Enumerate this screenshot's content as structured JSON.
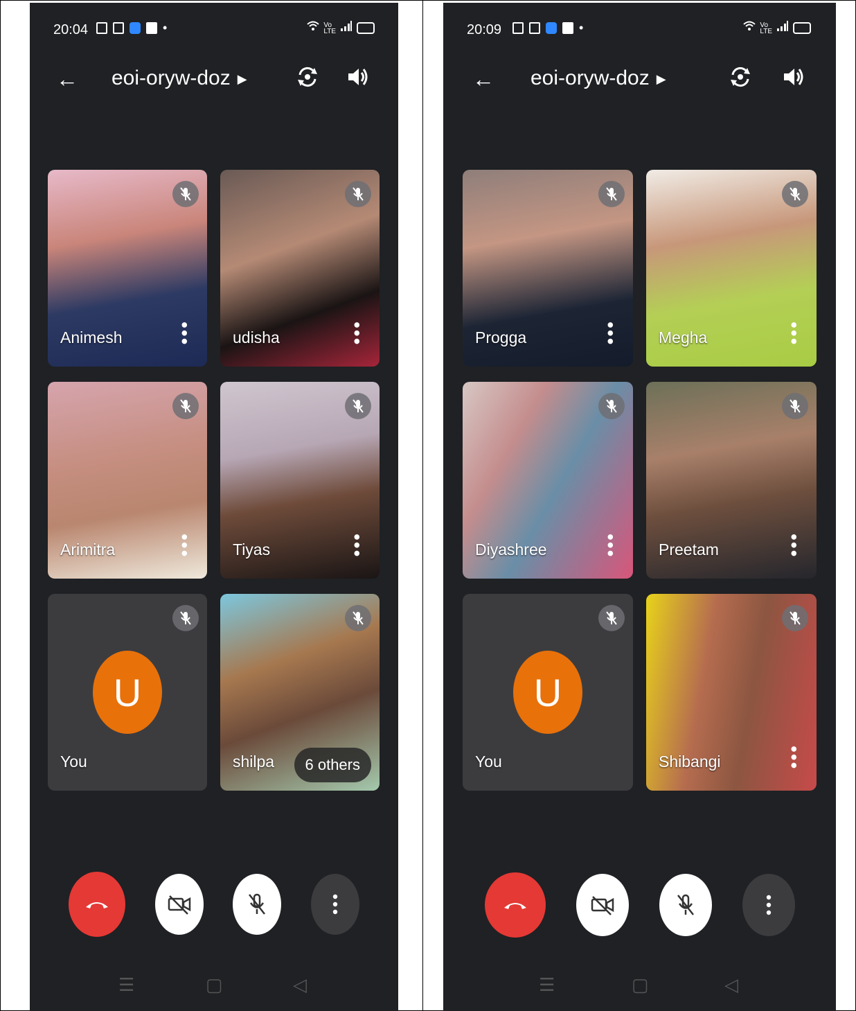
{
  "screens": [
    {
      "status": {
        "time": "20:04"
      },
      "meeting": {
        "title": "eoi-oryw-doz"
      },
      "participants": [
        {
          "name": "Animesh"
        },
        {
          "name": "udisha"
        },
        {
          "name": "Arimitra"
        },
        {
          "name": "Tiyas"
        },
        {
          "name": "You",
          "avatar_letter": "U"
        },
        {
          "name": "shilpa"
        }
      ],
      "others_label": "6 others"
    },
    {
      "status": {
        "time": "20:09"
      },
      "meeting": {
        "title": "eoi-oryw-doz"
      },
      "participants": [
        {
          "name": "Progga"
        },
        {
          "name": "Megha"
        },
        {
          "name": "Diyashree"
        },
        {
          "name": "Preetam"
        },
        {
          "name": "You",
          "avatar_letter": "U"
        },
        {
          "name": "Shibangi"
        }
      ]
    }
  ],
  "colors": {
    "end_call": "#e53935",
    "avatar": "#e8710a",
    "background": "#1f2124",
    "tile_self": "#3c3c3f"
  }
}
